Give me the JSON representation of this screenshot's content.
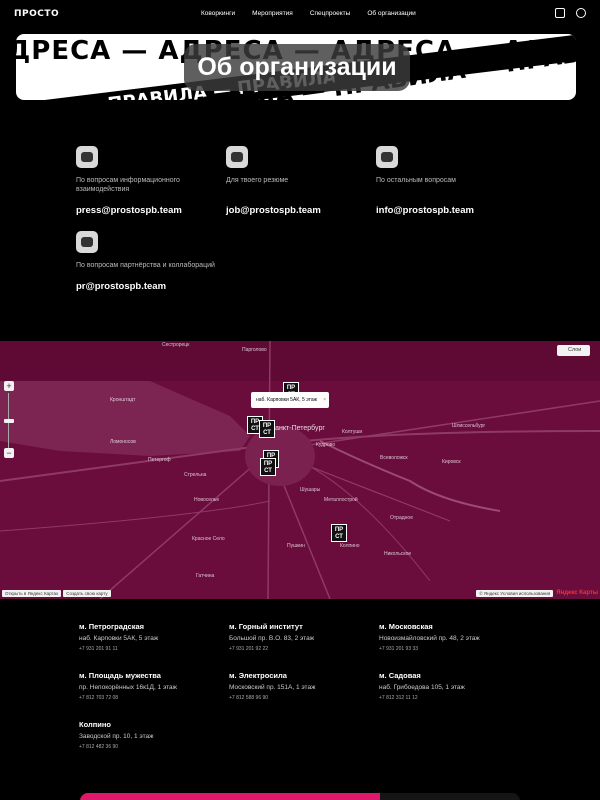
{
  "header": {
    "logo": "ПРОСТО",
    "nav": [
      "Коворкинги",
      "Мероприятия",
      "Спецпроекты",
      "Об организации"
    ]
  },
  "banner": {
    "title": "Об организации",
    "band_text_1": "АДРЕСА — АДРЕСА — АДРЕСА — АДРЕСА",
    "band_text_2": "ПРАВИЛА — ПРАВИЛА — ПРАВИЛА — ПРАВИЛА",
    "band_text_3": "ПРАВИЛА — ПРАВИЛА — ПРАВИЛА"
  },
  "contacts": [
    {
      "label": "По вопросам информационного взаимодействия",
      "email": "press@prostospb.team",
      "icon": "chat-icon"
    },
    {
      "label": "Для твоего резюме",
      "email": "job@prostospb.team",
      "icon": "resume-icon"
    },
    {
      "label": "По остальным вопросам",
      "email": "info@prostospb.team",
      "icon": "question-icon"
    },
    {
      "label": "По вопросам партнёрства и коллабораций",
      "email": "pr@prostospb.team",
      "icon": "partners-icon"
    }
  ],
  "map": {
    "layers_label": "Слои",
    "balloon": "наб. Карповки 5АК, 5 этаж",
    "marker_text": "ПР СТ",
    "open_in_yandex": "Открыть в Яндекс Картах",
    "create_map": "Создать свою карту",
    "yandex_terms": "© Яндекс Условия использования",
    "yandex_logo": "Яндекс Карты",
    "labels": {
      "city": "Санкт-Петербург",
      "sestroretsk": "Сестрорецк",
      "pargolovo": "Парголово",
      "kronshtadt": "Кронштадт",
      "lomonosov": "Ломоносов",
      "petergof": "Петергоф",
      "strelna": "Стрельна",
      "krasnoe_selo": "Красное Село",
      "pushkin": "Пушкин",
      "kolpino": "Колпино",
      "shushary": "Шушары",
      "kudrovo": "Кудрово",
      "koltushi": "Колтуши",
      "vsevolozhsk": "Всеволожск",
      "otradnoe": "Отрадное",
      "kirovsk": "Кировск",
      "shlisselburg": "Шлиссельбург",
      "nikolskoe": "Никольское",
      "gatchina": "Гатчина",
      "novoselye": "Новоселье",
      "metallostroy": "Металлострой"
    }
  },
  "addresses": [
    {
      "metro": "м. Петроградская",
      "street": "наб. Карповки 5АК, 5 этаж",
      "phone": "+7 931 201 91 11"
    },
    {
      "metro": "м. Горный институт",
      "street": "Большой пр. В.О. 83, 2 этаж",
      "phone": "+7 931 201 92 22"
    },
    {
      "metro": "м. Московская",
      "street": "Новоизмайловский пр. 48, 2 этаж",
      "phone": "+7 931 201 93 33"
    },
    {
      "metro": "м. Площадь мужества",
      "street": "пр. Непокорённых 16к1Д, 1 этаж",
      "phone": "+7 812 703 72 08"
    },
    {
      "metro": "м. Электросила",
      "street": "Московский пр. 151А, 1 этаж",
      "phone": "+7 812 588 96 90"
    },
    {
      "metro": "м. Садовая",
      "street": "наб. Грибоедова 105, 1 этаж",
      "phone": "+7 812 312 11 12"
    },
    {
      "metro": "Колпино",
      "street": "Заводской пр. 10, 1 этаж",
      "phone": "+7 812 482 36 90"
    }
  ]
}
